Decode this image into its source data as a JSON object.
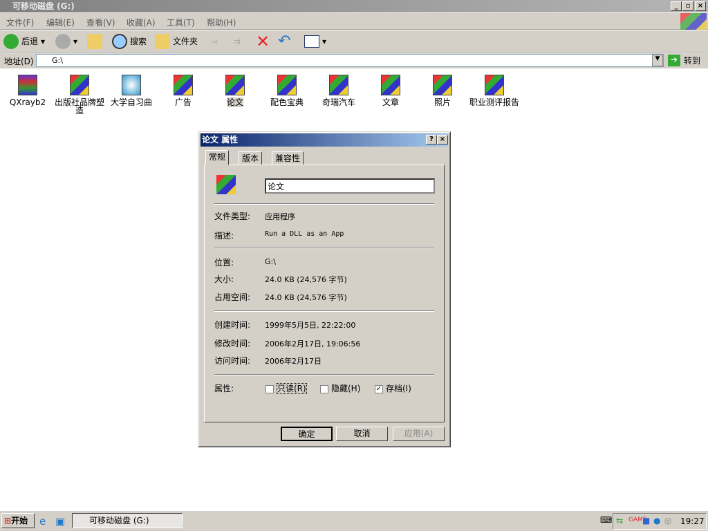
{
  "window": {
    "title": "可移动磁盘 (G:)"
  },
  "menu": [
    "文件(F)",
    "编辑(E)",
    "查看(V)",
    "收藏(A)",
    "工具(T)",
    "帮助(H)"
  ],
  "toolbar": {
    "back": "后退",
    "search": "搜索",
    "folders": "文件夹"
  },
  "address": {
    "label": "地址(D)",
    "value": "G:\\",
    "go": "转到"
  },
  "files": [
    "QXrayb2",
    "出版社品牌塑造",
    "大学自习曲",
    "广告",
    "论文",
    "配色宝典",
    "奇瑞汽车",
    "文章",
    "照片",
    "职业测评报告"
  ],
  "dialog": {
    "title": "论文 属性",
    "tabs": [
      "常规",
      "版本",
      "兼容性"
    ],
    "name": "论文",
    "file_type_label": "文件类型:",
    "file_type": "应用程序",
    "desc_label": "描述:",
    "desc": "Run a DLL as an App",
    "location_label": "位置:",
    "location": "G:\\",
    "size_label": "大小:",
    "size": "24.0 KB (24,576 字节)",
    "disk_label": "占用空间:",
    "disk": "24.0 KB (24,576 字节)",
    "created_label": "创建时间:",
    "created": "1999年5月5日, 22:22:00",
    "modified_label": "修改时间:",
    "modified": "2006年2月17日, 19:06:56",
    "accessed_label": "访问时间:",
    "accessed": "2006年2月17日",
    "attr_label": "属性:",
    "readonly": "只读(R)",
    "hidden": "隐藏(H)",
    "archive": "存档(I)",
    "ok": "确定",
    "cancel": "取消",
    "apply": "应用(A)"
  },
  "taskbar": {
    "start": "开始",
    "task": "可移动磁盘 (G:)",
    "clock": "19:27"
  }
}
